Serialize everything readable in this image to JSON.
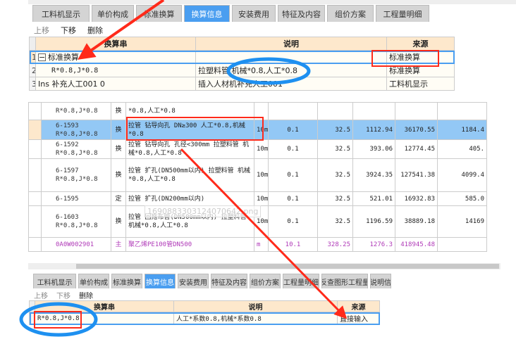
{
  "top_panel": {
    "tabs": [
      "工料机显示",
      "单价构成",
      "标准换算",
      "换算信息",
      "安装费用",
      "特征及内容",
      "组价方案",
      "工程量明细"
    ],
    "active_tab": 3,
    "toolbar": {
      "up": "上移",
      "down": "下移",
      "delete": "删除"
    },
    "columns": [
      "换算串",
      "说明",
      "来源"
    ],
    "rows": [
      {
        "num": "1",
        "expr": "标准换算",
        "desc": "",
        "source": "标准换算",
        "expand": "−"
      },
      {
        "num": "2",
        "expr": "R*0.8,J*0.8",
        "desc": "拉塑料管 机械*0.8,人工*0.8",
        "source": "标准换算"
      },
      {
        "num": "3",
        "expr": "Ins 补充人工001 0",
        "desc": "插入人材机补充人工001",
        "source": "工料机显示"
      }
    ]
  },
  "grid": {
    "rows": [
      {
        "code": "",
        "expr": "R*0.8,J*0.8",
        "type": "换",
        "desc": "*0.8,人工*0.8",
        "unit": "",
        "qty": "",
        "c1": "",
        "c2": "",
        "c3": "",
        "c4": ""
      },
      {
        "code": "6-1593",
        "expr": "R*0.8,J*0.8",
        "type": "换",
        "desc": "拉管 钻导向孔 DN≥300  人工*0.8,机械*0.8",
        "unit": "10m",
        "qty": "0.1",
        "c1": "32.5",
        "c2": "1112.94",
        "c3": "36170.55",
        "c4": "1184.4"
      },
      {
        "code": "6-1592",
        "expr": "R*0.8,J*0.8",
        "type": "换",
        "desc": "拉管 钻导向孔 孔径<300mm    拉塑料管 机械*0.8,人工*0.8",
        "unit": "10m",
        "qty": "0.1",
        "c1": "32.5",
        "c2": "393.06",
        "c3": "12774.45",
        "c4": "405."
      },
      {
        "code": "6-1597",
        "expr": "R*0.8,J*0.8",
        "type": "换",
        "desc": "拉管 扩孔(DN500mm以内)  拉塑料管 机械*0.8,人工*0.8",
        "unit": "10m",
        "qty": "0.1",
        "c1": "32.5",
        "c2": "3924.35",
        "c3": "127541.38",
        "c4": "4099.4"
      },
      {
        "code": "6-1595",
        "expr": "",
        "type": "定",
        "desc": "拉管 扩孔(DN200mm以内)",
        "unit": "10m",
        "qty": "0.1",
        "c1": "32.5",
        "c2": "521.01",
        "c3": "16932.83",
        "c4": "585.0"
      },
      {
        "code": "6-1603",
        "expr": "R*0.8,J*0.8",
        "type": "换",
        "desc": "拉管 回拖布管(DN500mm以内)  拉塑料管 机械*0.8,人工*0.8",
        "unit": "10m",
        "qty": "0.1",
        "c1": "32.5",
        "c2": "1196.59",
        "c3": "38889.18",
        "c4": "14169"
      },
      {
        "code": "0A0W002901",
        "expr": "",
        "type": "主",
        "desc": "聚乙烯PE100管DN500",
        "unit": "m",
        "qty": "10.1",
        "c1": "328.25",
        "c2": "1276.3",
        "c3": "418945.48",
        "c4": ""
      }
    ],
    "watermark": "1690883303124070642.png"
  },
  "bottom_panel": {
    "tabs": [
      "工料机显示",
      "单价构成",
      "标准换算",
      "换算信息",
      "安装费用",
      "特征及内容",
      "组价方案",
      "工程量明细",
      "反查图形工程量",
      "说明信"
    ],
    "active_tab": 3,
    "toolbar": {
      "up": "上移",
      "down": "下移",
      "delete": "删除"
    },
    "columns": [
      "换算串",
      "说明",
      "来源"
    ],
    "rows": [
      {
        "expr": "R*0.8,J*0.8",
        "desc": "人工*系数0.8,机械*系数0.8",
        "source": "直接输入"
      }
    ]
  },
  "colors": {
    "accent": "#4a9ef0",
    "header": "#fde8cc",
    "selected": "#93c8f5",
    "annotation_red": "#ff2a1a",
    "annotation_blue": "#1e90f0"
  }
}
